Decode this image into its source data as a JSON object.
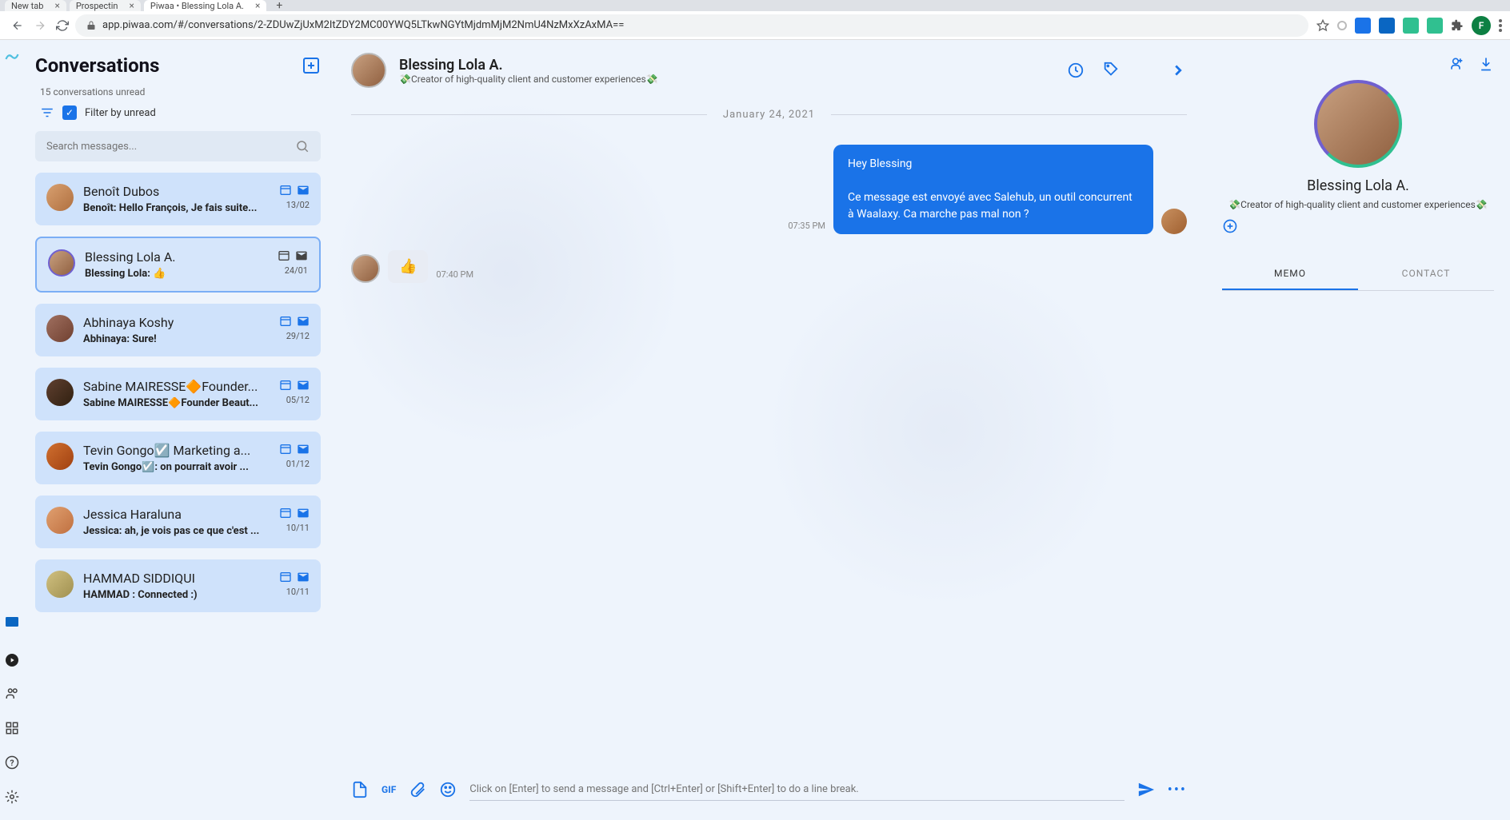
{
  "browser": {
    "tabs": [
      {
        "title": "New tab"
      },
      {
        "title": "Prospectin"
      },
      {
        "title": "Piwaa • Blessing Lola A."
      }
    ],
    "url": "app.piwaa.com/#/conversations/2-ZDUwZjUxM2ItZDY2MC00YWQ5LTkwNGYtMjdmMjM2NmU4NzMxXzAxMA=="
  },
  "sidebar": {
    "title": "Conversations",
    "unread": "15 conversations unread",
    "filter_label": "Filter by unread",
    "search_placeholder": "Search messages...",
    "items": [
      {
        "name": "Benoît Dubos",
        "preview": "Benoît: Hello François, Je fais suite...",
        "date": "13/02"
      },
      {
        "name": "Blessing Lola A.",
        "preview": "Blessing Lola: 👍",
        "date": "24/01"
      },
      {
        "name": "Abhinaya Koshy",
        "preview": "Abhinaya: Sure!",
        "date": "29/12"
      },
      {
        "name": "Sabine MAIRESSE🔶Founder...",
        "preview": "Sabine MAIRESSE🔶Founder Beaut...",
        "date": "05/12"
      },
      {
        "name": "Tevin Gongo☑️ Marketing a...",
        "preview": "Tevin Gongo☑️: on pourrait avoir ...",
        "date": "01/12"
      },
      {
        "name": "Jessica Haraluna",
        "preview": "Jessica: ah, je vois pas ce que c'est ...",
        "date": "10/11"
      },
      {
        "name": "HAMMAD SIDDIQUI",
        "preview": "HAMMAD : Connected :)",
        "date": "10/11"
      }
    ]
  },
  "chat": {
    "name": "Blessing Lola A.",
    "subtitle": "💸Creator of high-quality client and customer experiences💸",
    "date_divider": "January 24, 2021",
    "msg_out_line1": "Hey Blessing",
    "msg_out_line2": "Ce message est envoyé avec Salehub, un outil concurrent à Waalaxy. Ca marche pas mal non ?",
    "msg_out_time": "07:35 PM",
    "msg_in": "👍",
    "msg_in_time": "07:40 PM",
    "composer_placeholder": "Click on [Enter] to send a message and [Ctrl+Enter] or [Shift+Enter] to do a line break.",
    "gif_label": "GIF"
  },
  "right": {
    "name": "Blessing Lola A.",
    "subtitle": "💸Creator of high-quality client and customer experiences💸",
    "tab_memo": "MEMO",
    "tab_contact": "CONTACT"
  }
}
